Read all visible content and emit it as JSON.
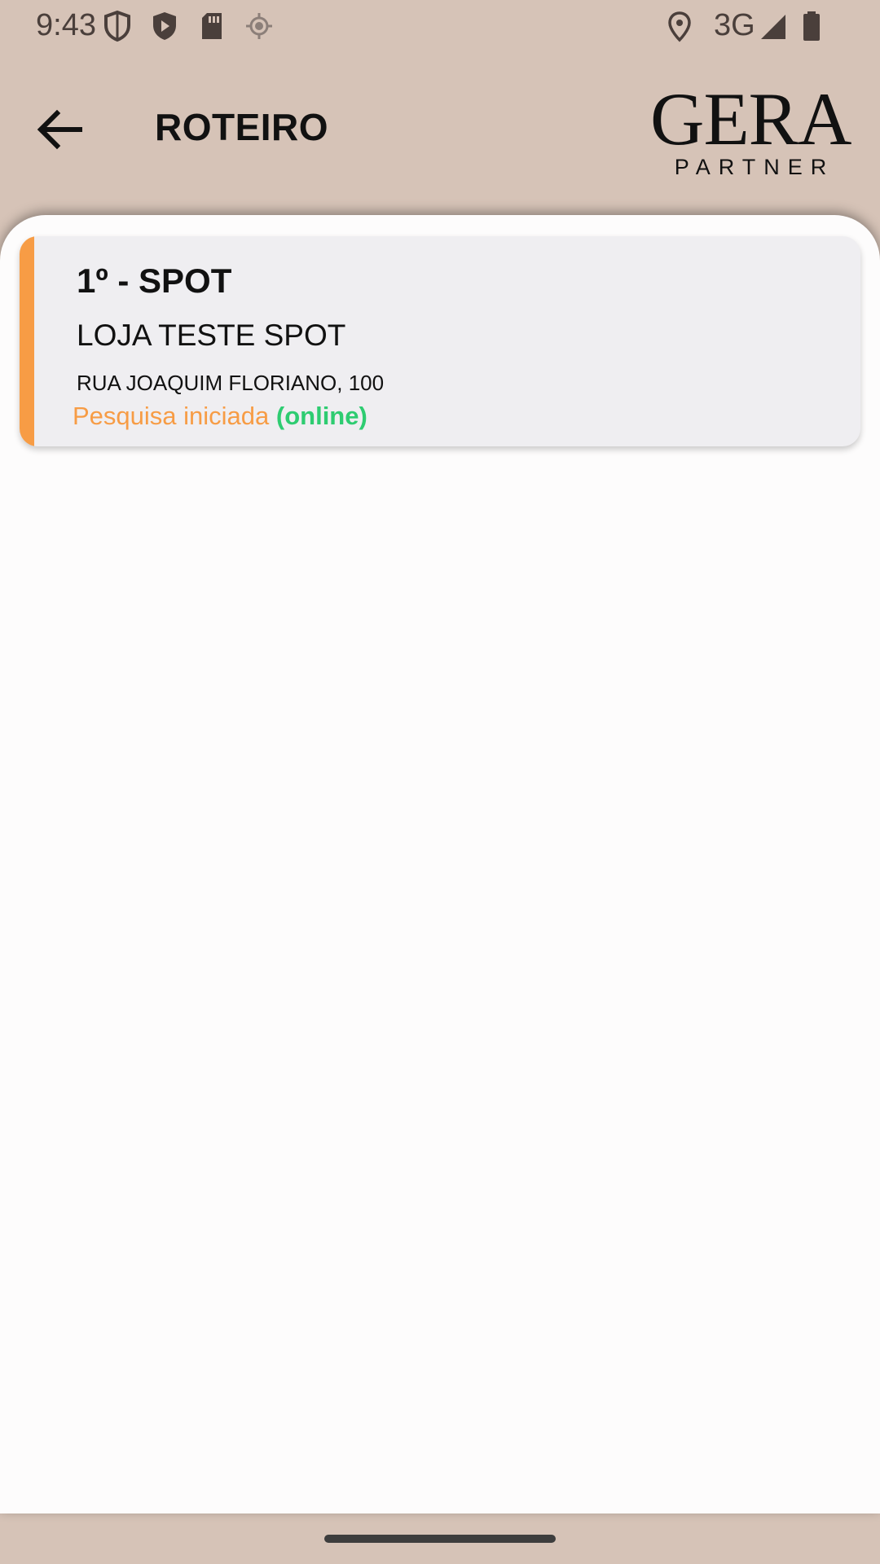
{
  "status_bar": {
    "time": "9:43",
    "network": "3G",
    "icons": [
      "shield-outline-icon",
      "play-shield-icon",
      "sd-card-icon",
      "gps-icon",
      "location-pin-icon",
      "signal-icon",
      "battery-icon"
    ]
  },
  "header": {
    "title": "ROTEIRO",
    "back_icon": "arrow-left-icon",
    "logo_main": "GERA",
    "logo_sub": "PARTNER"
  },
  "route_list": [
    {
      "title": "1º - SPOT",
      "store": "LOJA TESTE SPOT",
      "address": "RUA JOAQUIM FLORIANO, 100",
      "status_label": "Pesquisa iniciada",
      "status_mode": "(online)"
    }
  ],
  "colors": {
    "header_bg": "#d6c3b7",
    "accent": "#f79c45",
    "online": "#2ecc71",
    "card_bg": "#efeef1"
  }
}
